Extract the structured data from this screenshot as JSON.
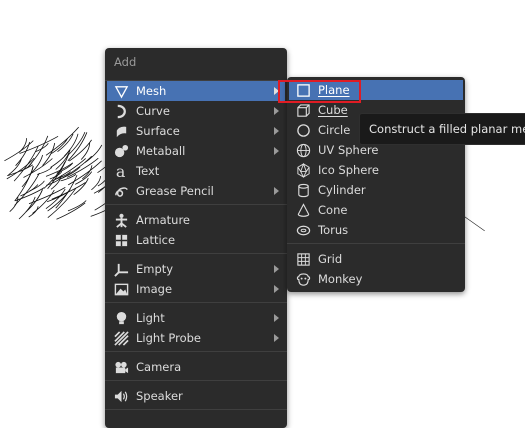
{
  "add_menu": {
    "title": "Add",
    "items": [
      {
        "label": "Mesh",
        "icon": "mesh-cone-icon",
        "submenu": true
      },
      {
        "label": "Curve",
        "icon": "curve-icon",
        "submenu": true
      },
      {
        "label": "Surface",
        "icon": "surface-icon",
        "submenu": true
      },
      {
        "label": "Metaball",
        "icon": "metaball-icon",
        "submenu": true
      },
      {
        "label": "Text",
        "icon": "text-icon",
        "submenu": false
      },
      {
        "label": "Grease Pencil",
        "icon": "grease-pencil-icon",
        "submenu": true
      },
      {
        "label": "Armature",
        "icon": "armature-icon",
        "submenu": false
      },
      {
        "label": "Lattice",
        "icon": "lattice-icon",
        "submenu": false
      },
      {
        "label": "Empty",
        "icon": "empty-axes-icon",
        "submenu": true
      },
      {
        "label": "Image",
        "icon": "image-icon",
        "submenu": true
      },
      {
        "label": "Light",
        "icon": "light-bulb-icon",
        "submenu": true
      },
      {
        "label": "Light Probe",
        "icon": "light-probe-icon",
        "submenu": true
      },
      {
        "label": "Camera",
        "icon": "camera-icon",
        "submenu": false
      },
      {
        "label": "Speaker",
        "icon": "speaker-icon",
        "submenu": false
      }
    ]
  },
  "mesh_menu": {
    "items": [
      {
        "label": "Plane",
        "icon": "plane-icon"
      },
      {
        "label": "Cube",
        "icon": "cube-icon"
      },
      {
        "label": "Circle",
        "icon": "circle-icon"
      },
      {
        "label": "UV Sphere",
        "icon": "uv-sphere-icon"
      },
      {
        "label": "Ico Sphere",
        "icon": "ico-sphere-icon"
      },
      {
        "label": "Cylinder",
        "icon": "cylinder-icon"
      },
      {
        "label": "Cone",
        "icon": "cone-icon"
      },
      {
        "label": "Torus",
        "icon": "torus-icon"
      },
      {
        "label": "Grid",
        "icon": "grid-icon"
      },
      {
        "label": "Monkey",
        "icon": "monkey-icon"
      }
    ]
  },
  "tooltip": {
    "text": "Construct a filled planar mesh w"
  },
  "colors": {
    "menu_bg": "#2b2b2b",
    "active_bg": "#4772b3",
    "highlight_border": "#e01c24"
  }
}
